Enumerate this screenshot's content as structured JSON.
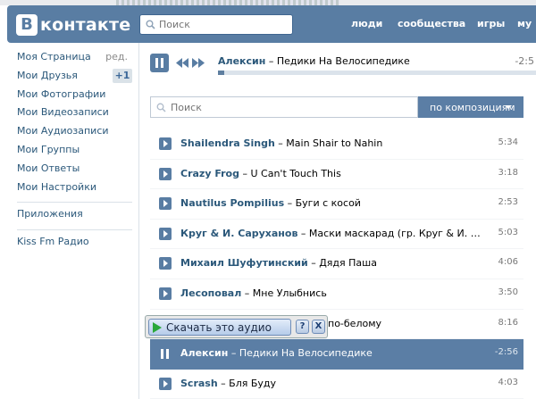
{
  "header": {
    "logo_letter": "В",
    "logo_text": "контакте",
    "search_placeholder": "Поиск",
    "nav": [
      "люди",
      "сообщества",
      "игры",
      "му"
    ]
  },
  "sidebar": {
    "items": [
      {
        "label": "Моя Страница",
        "extra": "ред."
      },
      {
        "label": "Мои Друзья",
        "badge": "+1"
      },
      {
        "label": "Мои Фотографии"
      },
      {
        "label": "Мои Видеозаписи"
      },
      {
        "label": "Мои Аудиозаписи"
      },
      {
        "label": "Мои Группы"
      },
      {
        "label": "Мои Ответы"
      },
      {
        "label": "Мои Настройки"
      }
    ],
    "apps": "Приложения",
    "extra_link": "Kiss Fm Радио"
  },
  "player": {
    "artist": "Алексин",
    "title": " – Педики На Велосипедике",
    "time": "-2:5",
    "progress": 0.02
  },
  "audio_search": {
    "placeholder": "Поиск",
    "filter_label": "по композициям"
  },
  "tracks": [
    {
      "artist": "Shailendra Singh",
      "title": " – Main Shair to Nahin",
      "duration": "5:34"
    },
    {
      "artist": "Crazy Frog",
      "title": " – U Can't Touch This",
      "duration": "3:18"
    },
    {
      "artist": "Nautilus Pompilius",
      "title": " – Буги с косой",
      "duration": "2:53"
    },
    {
      "artist": "Круг & И. Саруханов",
      "title": " – Маски маскарад (гр. Круг & И. Сарух…",
      "duration": "5:03"
    },
    {
      "artist": "Михаил Шуфутинский",
      "title": " – Дядя Паша",
      "duration": "4:06"
    },
    {
      "artist": "Лесоповал",
      "title": " – Мне Улыбнись",
      "duration": "3:50"
    },
    {
      "artist": "",
      "title": "по-белому",
      "duration": "8:16"
    },
    {
      "artist": "Алексин",
      "title": " – Педики На Велосипедике",
      "duration": "-2:56",
      "active": true
    },
    {
      "artist": "Scrash",
      "title": " – Бля Буду",
      "duration": "4:03"
    }
  ],
  "download": {
    "label": "Скачать это аудио",
    "help": "?",
    "close": "X"
  }
}
